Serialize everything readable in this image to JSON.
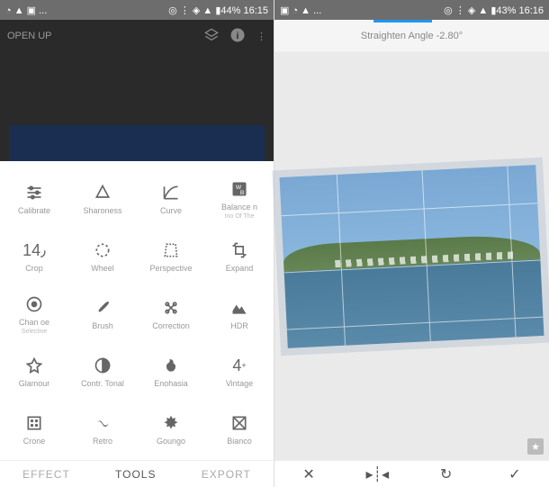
{
  "left": {
    "status": {
      "icons": "◔ ▲ ▣ ...",
      "right": "◎ ⋮ ◈ ▲ ▮44% 16:15"
    },
    "header": {
      "title": "OPEN UP"
    },
    "tools": [
      [
        {
          "icon": "sliders",
          "label": "Calibrate"
        },
        {
          "icon": "sharpness",
          "label": "Sharoness"
        },
        {
          "icon": "curve",
          "label": "Curve"
        },
        {
          "icon": "wb",
          "label": "Balance n",
          "sub": "Ino Of The"
        }
      ],
      [
        {
          "icon": "crop14",
          "label": "Crop"
        },
        {
          "icon": "wheel",
          "label": "Wheel"
        },
        {
          "icon": "perspective",
          "label": "Perspective"
        },
        {
          "icon": "expand",
          "label": "Expand"
        }
      ],
      [
        {
          "icon": "selective",
          "label": "Chan oe",
          "sub": "Selective"
        },
        {
          "icon": "brush",
          "label": "Brush"
        },
        {
          "icon": "heal",
          "label": "Correction"
        },
        {
          "icon": "hdr",
          "label": "HDR"
        }
      ],
      [
        {
          "icon": "glamour",
          "label": "Glamour"
        },
        {
          "icon": "tonal",
          "label": "Contr. Tonal"
        },
        {
          "icon": "drama",
          "label": "Enohasia"
        },
        {
          "icon": "vintage",
          "label": "Vintage"
        }
      ],
      [
        {
          "icon": "grainy",
          "label": "Crone"
        },
        {
          "icon": "retro",
          "label": "Retro"
        },
        {
          "icon": "grunge",
          "label": "Goungo"
        },
        {
          "icon": "bw",
          "label": "Bianco"
        }
      ]
    ],
    "tabs": {
      "effect": "EFFECT",
      "tools": "TOOLS",
      "export": "EXPORT"
    }
  },
  "right": {
    "status": {
      "icons": "▣ ◔ ▲ ...",
      "right": "◎ ⋮ ◈ ▲ ▮43% 16:16"
    },
    "straighten_label": "Straighten Angle -2.80°",
    "bottom": {
      "cancel": "✕",
      "flip": "▸┊◂",
      "rotate": "↻",
      "apply": "✓"
    }
  }
}
